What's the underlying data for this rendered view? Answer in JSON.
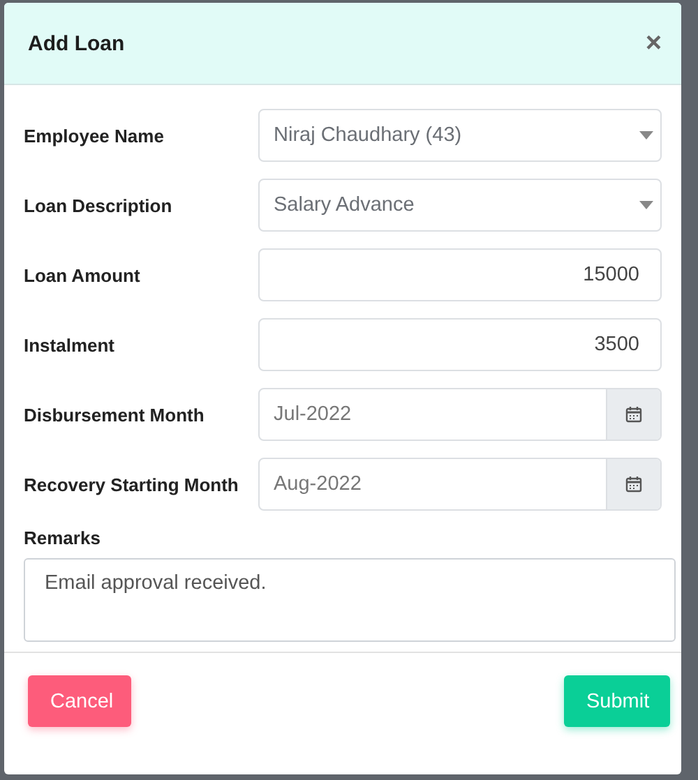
{
  "dialog": {
    "title": "Add Loan",
    "close": "×"
  },
  "fields": [
    {
      "label": "Employee Name",
      "kind": "select",
      "value": "Niraj Chaudhary (43)"
    },
    {
      "label": "Loan Description",
      "kind": "select",
      "value": "Salary Advance"
    },
    {
      "label": "Loan Amount",
      "kind": "number",
      "value": "15000"
    },
    {
      "label": "Instalment",
      "kind": "number",
      "value": "3500"
    },
    {
      "label": "Disbursement Month",
      "kind": "month",
      "value": "Jul-2022"
    },
    {
      "label": "Recovery Starting Month",
      "kind": "month",
      "value": "Aug-2022"
    }
  ],
  "remarks": {
    "label": "Remarks",
    "value": "Email approval received."
  },
  "buttons": [
    {
      "label": "Cancel",
      "kind": "cancel"
    },
    {
      "label": "Submit",
      "kind": "submit"
    }
  ]
}
